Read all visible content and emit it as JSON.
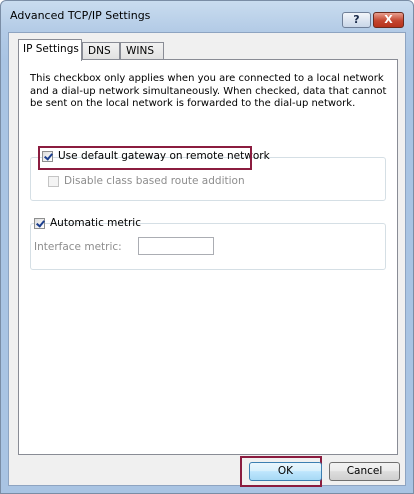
{
  "window": {
    "title": "Advanced TCP/IP Settings",
    "help_label": "?",
    "close_label": "X"
  },
  "tabs": [
    {
      "label": "IP Settings",
      "active": true
    },
    {
      "label": "DNS",
      "active": false
    },
    {
      "label": "WINS",
      "active": false
    }
  ],
  "ip_settings": {
    "description": "This checkbox only applies when you are connected to a local network and a dial-up network simultaneously.  When checked, data that cannot be sent on the local network is forwarded to the dial-up network.",
    "use_default_gateway": {
      "label": "Use default gateway on remote network",
      "checked": true,
      "enabled": true
    },
    "disable_class_based": {
      "label": "Disable class based route addition",
      "checked": false,
      "enabled": false
    },
    "automatic_metric": {
      "label": "Automatic metric",
      "checked": true,
      "enabled": true
    },
    "interface_metric": {
      "label": "Interface metric:",
      "value": "",
      "enabled": false
    }
  },
  "buttons": {
    "ok_label": "OK",
    "cancel_label": "Cancel"
  },
  "colors": {
    "highlight": "#8b1c3f",
    "title_gradient": "#b3cbe6",
    "close_button": "#c4452f"
  }
}
